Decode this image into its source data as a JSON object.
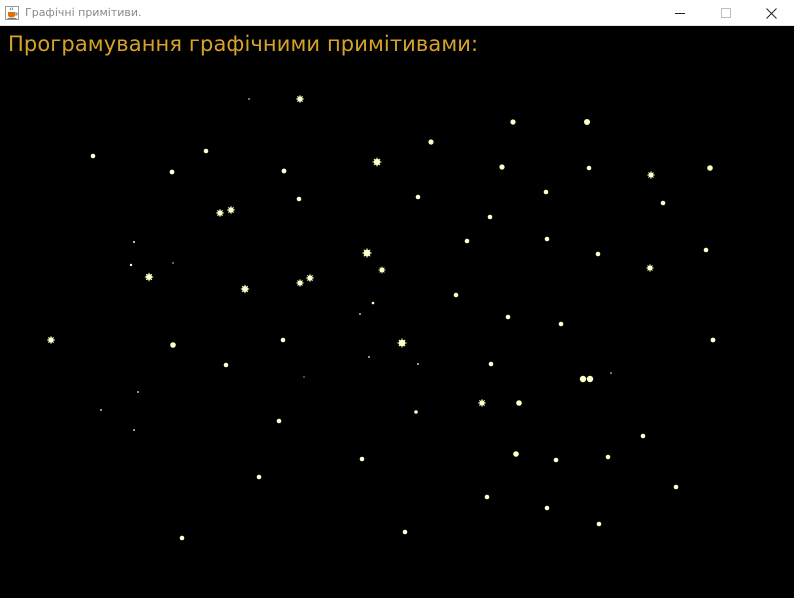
{
  "window": {
    "title": "Графічні примітиви.",
    "app_icon": "java-cup-icon",
    "controls": {
      "minimize": "minimize-icon",
      "maximize": "maximize-icon",
      "close": "close-icon"
    }
  },
  "canvas": {
    "heading": "Програмування графічними примітивами:",
    "heading_color": "#d6a22c",
    "background_color": "#000000",
    "star_color": "#ffffc8"
  }
}
